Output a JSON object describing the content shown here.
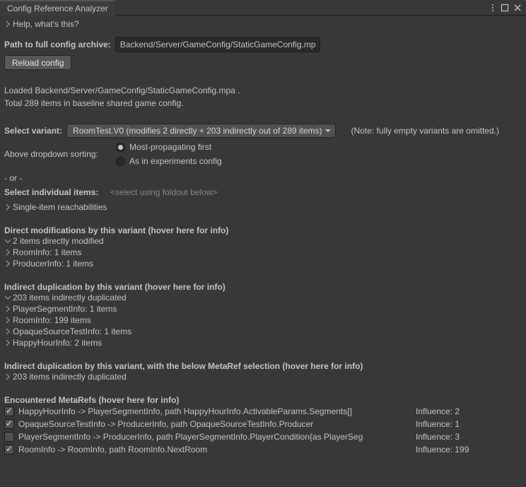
{
  "window": {
    "title": "Config Reference Analyzer"
  },
  "help": {
    "label": "Help, what's this?"
  },
  "path": {
    "label": "Path to full config archive:",
    "value": "Backend/Server/GameConfig/StaticGameConfig.mpa"
  },
  "reload": {
    "label": "Reload config"
  },
  "status": {
    "loaded": "Loaded Backend/Server/GameConfig/StaticGameConfig.mpa .",
    "total": "Total 289 items in baseline shared game config."
  },
  "variant": {
    "label": "Select variant:",
    "selected": "RoomTest.V0 (modifies 2 directly + 203 indirectly out of 289 items)",
    "note": "(Note: fully empty variants are omitted.)"
  },
  "sorting": {
    "label": "Above dropdown sorting:",
    "opt1": "Most-propagating first",
    "opt2": "As in experiments config"
  },
  "or": "- or -",
  "individual": {
    "label": "Select individual items:",
    "placeholder": "<select using foldout below>"
  },
  "single_reach": {
    "label": "Single-item reachabilities"
  },
  "direct": {
    "heading": "Direct modifications by this variant (hover here for info)",
    "summary": "2 items directly modified",
    "items": [
      "RoomInfo: 1 items",
      "ProducerInfo: 1 items"
    ]
  },
  "indirect": {
    "heading": "Indirect duplication by this variant (hover here for info)",
    "summary": "203 items indirectly duplicated",
    "items": [
      "PlayerSegmentInfo: 1 items",
      "RoomInfo: 199 items",
      "OpaqueSourceTestInfo: 1 items",
      "HappyHourInfo: 2 items"
    ]
  },
  "indirect_meta": {
    "heading": "Indirect duplication by this variant, with the below MetaRef selection (hover here for info)",
    "summary": "203 items indirectly duplicated"
  },
  "metarefs": {
    "heading": "Encountered MetaRefs (hover here for info)",
    "rows": [
      {
        "checked": true,
        "text": "HappyHourInfo -> PlayerSegmentInfo, path HappyHourInfo.ActivableParams.Segments[]",
        "influence": "Influence: 2"
      },
      {
        "checked": true,
        "text": "OpaqueSourceTestInfo -> ProducerInfo, path OpaqueSourceTestInfo.Producer",
        "influence": "Influence: 1"
      },
      {
        "checked": false,
        "text": "PlayerSegmentInfo -> ProducerInfo, path PlayerSegmentInfo.PlayerCondition{as PlayerSeg",
        "influence": "Influence: 3"
      },
      {
        "checked": true,
        "text": "RoomInfo -> RoomInfo, path RoomInfo.NextRoom",
        "influence": "Influence: 199"
      }
    ]
  }
}
